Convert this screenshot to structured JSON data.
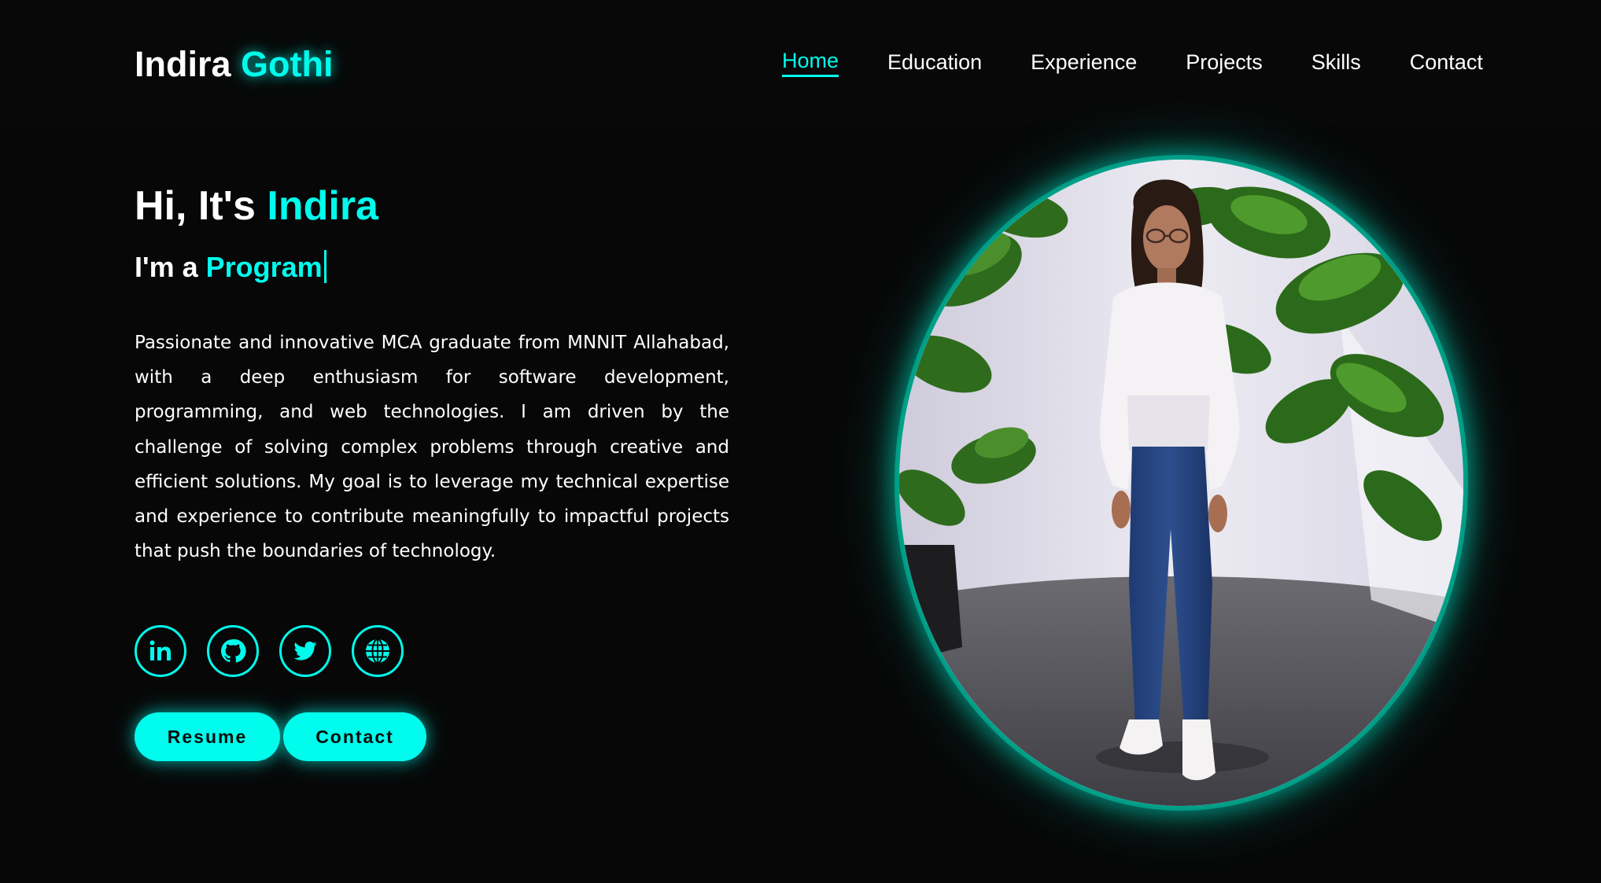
{
  "logo": {
    "first": "Indira ",
    "second": "Gothi"
  },
  "nav": {
    "items": [
      {
        "label": "Home",
        "active": true
      },
      {
        "label": "Education",
        "active": false
      },
      {
        "label": "Experience",
        "active": false
      },
      {
        "label": "Projects",
        "active": false
      },
      {
        "label": "Skills",
        "active": false
      },
      {
        "label": "Contact",
        "active": false
      }
    ]
  },
  "hero": {
    "greeting_prefix": "Hi, It's ",
    "greeting_name": "Indira",
    "role_prefix": "I'm a ",
    "role_typed": "Program",
    "bio": "Passionate and innovative MCA graduate from MNNIT Allahabad, with a deep enthusiasm for software development, programming, and web technologies. I am driven by the challenge of solving complex problems through creative and efficient solutions. My goal is to leverage my technical expertise and experience to contribute meaningfully to impactful projects that push the boundaries of technology."
  },
  "socials": [
    {
      "icon": "linkedin-icon"
    },
    {
      "icon": "github-icon"
    },
    {
      "icon": "twitter-icon"
    },
    {
      "icon": "globe-icon"
    }
  ],
  "buttons": {
    "resume": "Resume",
    "contact": "Contact"
  },
  "colors": {
    "background": "#070707",
    "accent": "#00fcec",
    "text": "#ffffff"
  }
}
